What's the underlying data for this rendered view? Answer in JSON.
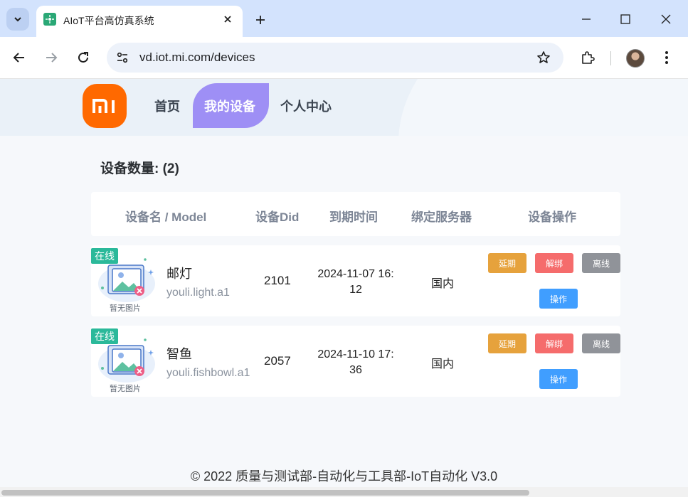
{
  "browser": {
    "tab_title": "AIoT平台高仿真系统",
    "url": "vd.iot.mi.com/devices"
  },
  "header": {
    "logo_text": "mi",
    "nav": [
      "首页",
      "我的设备",
      "个人中心"
    ],
    "active_nav": "我的设备"
  },
  "device_count_label": "设备数量: (2)",
  "table": {
    "columns": [
      "设备名 / Model",
      "设备Did",
      "到期时间",
      "绑定服务器",
      "设备操作"
    ],
    "rows": [
      {
        "status": "在线",
        "no_image": "暂无图片",
        "name": "邮灯",
        "model": "youli.light.a1",
        "did": "2101",
        "expire_line1": "2024-11-07 16:",
        "expire_line2": "12",
        "server": "国内"
      },
      {
        "status": "在线",
        "no_image": "暂无图片",
        "name": "智鱼",
        "model": "youli.fishbowl.a1",
        "did": "2057",
        "expire_line1": "2024-11-10 17:",
        "expire_line2": "36",
        "server": "国内"
      }
    ],
    "actions": {
      "extend": "延期",
      "unbind": "解绑",
      "offline": "离线",
      "operate": "操作"
    }
  },
  "colors": {
    "brand": "#ff6900",
    "nav_active": "#9e8ff5",
    "status_online": "#2bb99a",
    "extend": "#e6a23c",
    "unbind": "#f56c6c",
    "offline": "#909399",
    "operate": "#409eff"
  },
  "icons": [
    "chevron-down-icon",
    "plus-icon",
    "close-icon",
    "minimize-icon",
    "maximize-icon",
    "back-icon",
    "forward-icon",
    "reload-icon",
    "site-info-icon",
    "star-icon",
    "extensions-icon",
    "kebab-menu-icon",
    "image-placeholder-icon"
  ],
  "footer": "© 2022 质量与测试部-自动化与工具部-IoT自动化 V3.0"
}
